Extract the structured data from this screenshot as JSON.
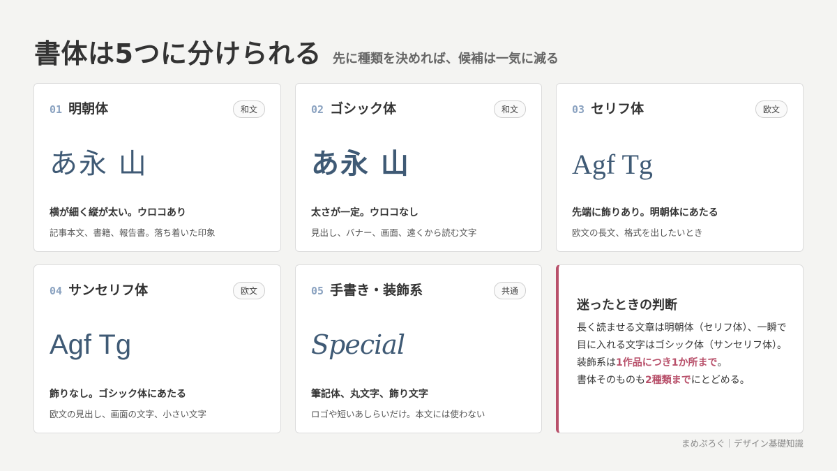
{
  "header": {
    "title": "書体は5つに分けられる",
    "subtitle": "先に種類を決めれば、候補は一気に減る"
  },
  "cards": [
    {
      "num": "01",
      "name": "明朝体",
      "badge": "和文",
      "sample": "あ永 山",
      "desc_main": "横が細く縦が太い。ウロコあり",
      "desc_sub": "記事本文、書籍、報告書。落ち着いた印象"
    },
    {
      "num": "02",
      "name": "ゴシック体",
      "badge": "和文",
      "sample": "あ永 山",
      "desc_main": "太さが一定。ウロコなし",
      "desc_sub": "見出し、バナー、画面、遠くから読む文字"
    },
    {
      "num": "03",
      "name": "セリフ体",
      "badge": "欧文",
      "sample": "Agf Tg",
      "desc_main": "先端に飾りあり。明朝体にあたる",
      "desc_sub": "欧文の長文、格式を出したいとき"
    },
    {
      "num": "04",
      "name": "サンセリフ体",
      "badge": "欧文",
      "sample": "Agf Tg",
      "desc_main": "飾りなし。ゴシック体にあたる",
      "desc_sub": "欧文の見出し、画面の文字、小さい文字"
    },
    {
      "num": "05",
      "name": "手書き・装飾系",
      "badge": "共通",
      "sample": "Special",
      "desc_main": "筆記体、丸文字、飾り文字",
      "desc_sub": "ロゴや短いあしらいだけ。本文には使わない"
    }
  ],
  "note": {
    "title": "迷ったときの判断",
    "line1": "長く読ませる文章は明朝体（セリフ体）、一瞬で目に入れる文字はゴシック体（サンセリフ体）。",
    "line2_pre": "装飾系は",
    "line2_hl": "1作品につき1か所まで",
    "line2_post": "。",
    "line3_pre": "書体そのものも",
    "line3_hl": "2種類まで",
    "line3_post": "にとどめる。"
  },
  "footer": "まめぷろぐ｜デザイン基礎知識",
  "colors": {
    "accent": "#b8506a",
    "sample": "#3f5a75",
    "number": "#8aa2c0"
  }
}
